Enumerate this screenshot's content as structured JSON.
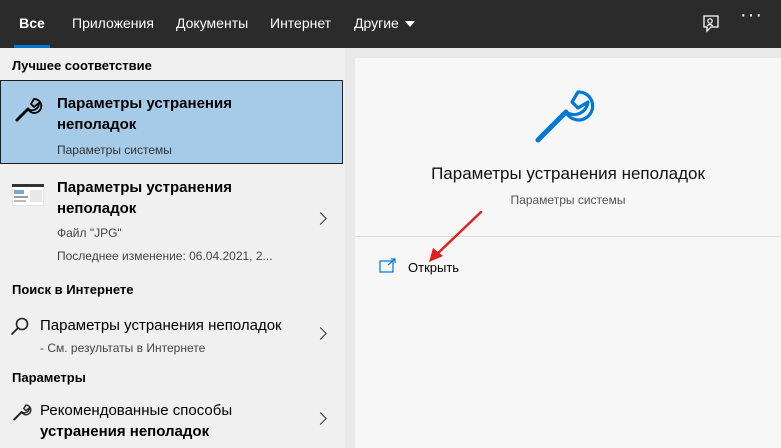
{
  "tabs": [
    {
      "label": "Все",
      "active": true
    },
    {
      "label": "Приложения"
    },
    {
      "label": "Документы"
    },
    {
      "label": "Интернет"
    },
    {
      "label": "Другие",
      "dropdown": true
    }
  ],
  "topbar_icons": [
    "feedback-icon",
    "more-options-icon"
  ],
  "more_label": "···",
  "best_match": {
    "section": "Лучшее соответствие",
    "title_line1": "Параметры устранения",
    "title_line2": "неполадок",
    "subtitle": "Параметры системы",
    "icon": "wrench-icon"
  },
  "file_result": {
    "title_line1": "Параметры устранения",
    "title_line2": "неполадок",
    "type": "Файл \"JPG\"",
    "modified": "Последнее изменение: 06.04.2021, 2...",
    "icon": "image-thumbnail"
  },
  "web": {
    "section": "Поиск в Интернете",
    "title": "Параметры устранения неполадок",
    "subtitle": "- См. результаты в Интернете",
    "icon": "search-icon"
  },
  "settings": {
    "section": "Параметры",
    "title_line1": "Рекомендованные способы",
    "title_line2": "устранения неполадок",
    "icon": "wrench-icon"
  },
  "preview": {
    "title": "Параметры устранения неполадок",
    "subtitle": "Параметры системы",
    "icon": "wrench-icon",
    "open_label": "Открыть",
    "open_icon": "open-icon"
  },
  "colors": {
    "topbar_bg": "#2b2b2b",
    "accent": "#0078d7",
    "selected_bg": "#a6cbe8",
    "annotation_arrow": "#e0201c"
  }
}
